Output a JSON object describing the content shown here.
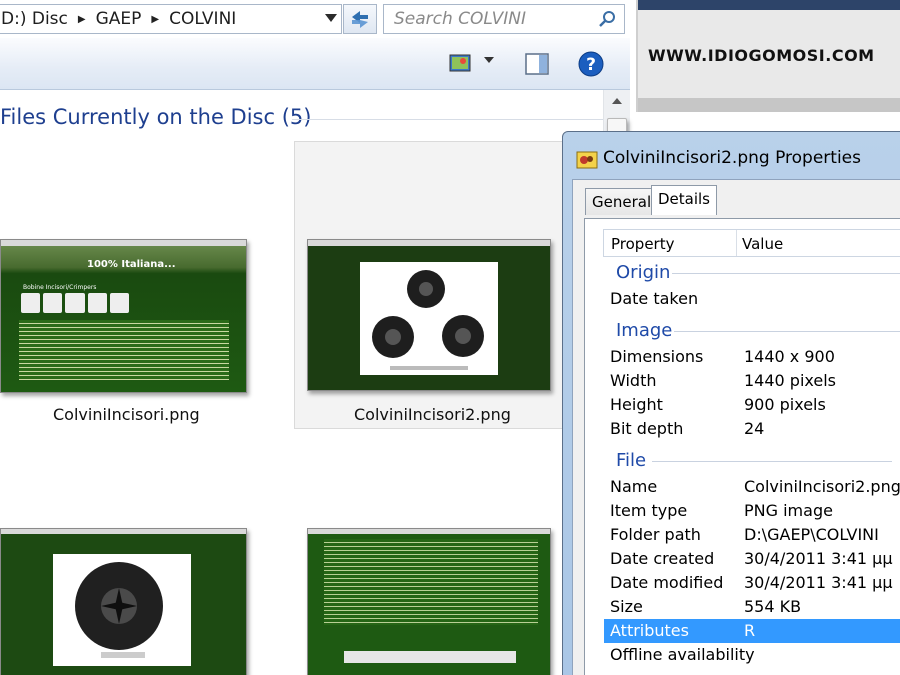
{
  "breadcrumb": {
    "items": [
      "D:) Disc",
      "GAEP",
      "COLVINI"
    ]
  },
  "search": {
    "placeholder": "Search COLVINI"
  },
  "group": {
    "title": "Files Currently on the Disc (5)"
  },
  "files": [
    {
      "name": "ColviniIncisori.png"
    },
    {
      "name": "ColviniIncisori2.png"
    },
    {
      "name": ""
    },
    {
      "name": ""
    }
  ],
  "thumb_texts": {
    "banner": "100% Italiana...",
    "heading": "Bobine Incisori/Crimpers"
  },
  "website": {
    "logo": "WWW.IDIOGOMOSI.COM"
  },
  "dialog": {
    "title": "ColviniIncisori2.png Properties",
    "tabs": [
      "General",
      "Details"
    ],
    "columns": {
      "property": "Property",
      "value": "Value"
    },
    "sections": {
      "origin": "Origin",
      "image": "Image",
      "file": "File"
    },
    "rows": {
      "date_taken": {
        "p": "Date taken",
        "v": ""
      },
      "dimensions": {
        "p": "Dimensions",
        "v": "1440 x 900"
      },
      "width": {
        "p": "Width",
        "v": "1440 pixels"
      },
      "height": {
        "p": "Height",
        "v": "900 pixels"
      },
      "bit_depth": {
        "p": "Bit depth",
        "v": "24"
      },
      "name": {
        "p": "Name",
        "v": "ColviniIncisori2.png"
      },
      "item_type": {
        "p": "Item type",
        "v": "PNG image"
      },
      "folder_path": {
        "p": "Folder path",
        "v": "D:\\GAEP\\COLVINI"
      },
      "date_created": {
        "p": "Date created",
        "v": "30/4/2011 3:41 μμ"
      },
      "date_modified": {
        "p": "Date modified",
        "v": "30/4/2011 3:41 μμ"
      },
      "size": {
        "p": "Size",
        "v": "554 KB"
      },
      "attributes": {
        "p": "Attributes",
        "v": "R"
      },
      "offline_availability": {
        "p": "Offline availability",
        "v": ""
      }
    }
  },
  "colors": {
    "accent_blue": "#1e3f8f",
    "selection": "#3399ff",
    "thumb_green": "#1f5a12"
  }
}
